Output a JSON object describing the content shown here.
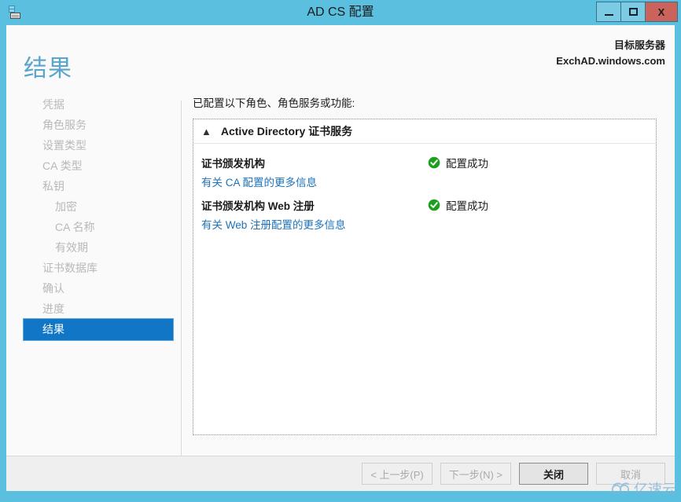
{
  "window": {
    "title": "AD CS 配置",
    "icon": "server-config-icon",
    "buttons": {
      "minimize": "minimize-icon",
      "maximize": "maximize-icon",
      "close": "X"
    },
    "accent_color": "#5bbfe0"
  },
  "header": {
    "page_title": "结果",
    "page_title_color": "#5aa5cd",
    "server_label": "目标服务器",
    "server_name": "ExchAD.windows.com"
  },
  "sidebar": {
    "items": [
      {
        "label": "凭据",
        "sub": false,
        "active": false
      },
      {
        "label": "角色服务",
        "sub": false,
        "active": false
      },
      {
        "label": "设置类型",
        "sub": false,
        "active": false
      },
      {
        "label": "CA 类型",
        "sub": false,
        "active": false
      },
      {
        "label": "私钥",
        "sub": false,
        "active": false
      },
      {
        "label": "加密",
        "sub": true,
        "active": false
      },
      {
        "label": "CA 名称",
        "sub": true,
        "active": false
      },
      {
        "label": "有效期",
        "sub": true,
        "active": false
      },
      {
        "label": "证书数据库",
        "sub": false,
        "active": false
      },
      {
        "label": "确认",
        "sub": false,
        "active": false
      },
      {
        "label": "进度",
        "sub": false,
        "active": false
      },
      {
        "label": "结果",
        "sub": false,
        "active": true
      }
    ],
    "active_color": "#1176c5"
  },
  "main": {
    "intro": "已配置以下角色、角色服务或功能:",
    "panel": {
      "collapse_icon": "chevron-up-icon",
      "title": "Active Directory 证书服务",
      "rows": [
        {
          "name": "证书颁发机构",
          "status": "配置成功",
          "status_icon": "success-check-icon",
          "status_color": "#1aa01a",
          "link": "有关 CA 配置的更多信息"
        },
        {
          "name": "证书颁发机构 Web 注册",
          "status": "配置成功",
          "status_icon": "success-check-icon",
          "status_color": "#1aa01a",
          "link": "有关 Web 注册配置的更多信息"
        }
      ]
    }
  },
  "footer": {
    "previous": "< 上一步(P)",
    "next": "下一步(N) >",
    "close": "关闭",
    "cancel": "取消"
  },
  "watermark": {
    "text": "亿速云",
    "logo": "cloud-66-logo",
    "color": "#7fb4d6"
  }
}
